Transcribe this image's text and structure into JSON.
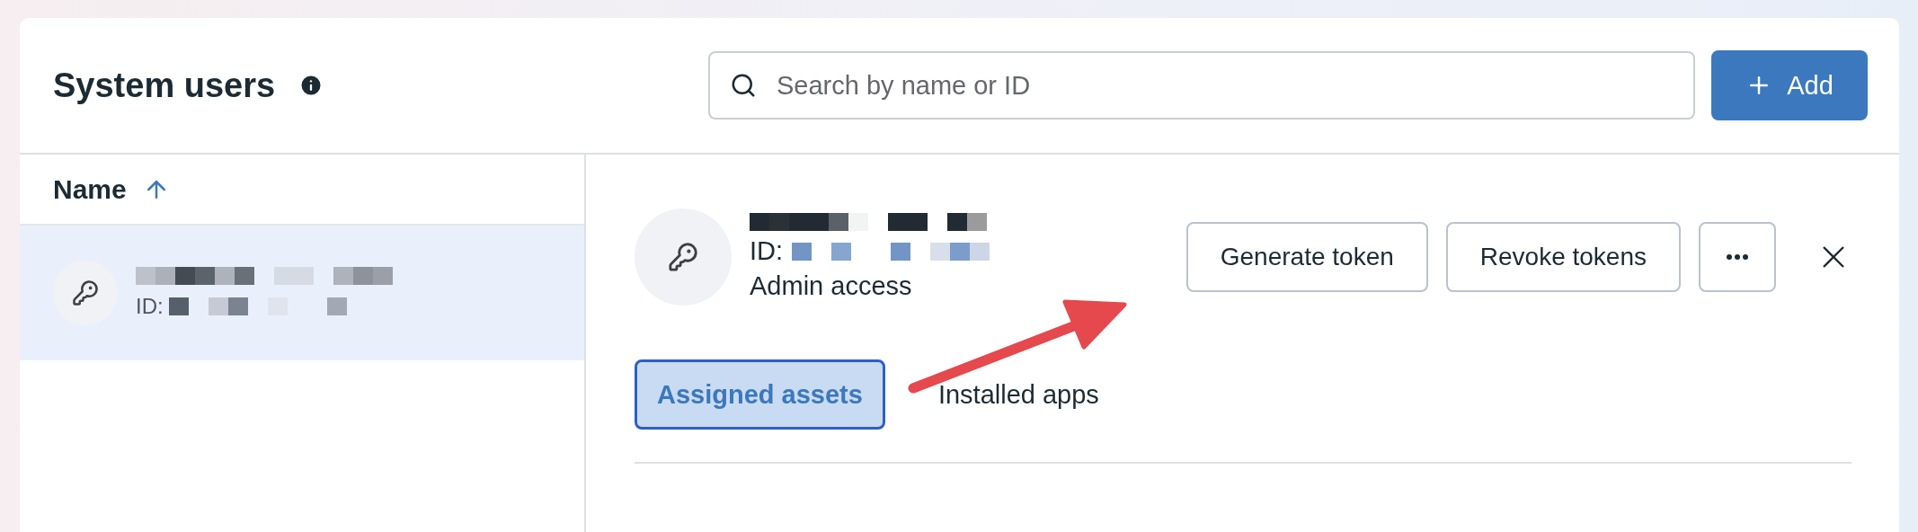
{
  "header": {
    "title": "System users",
    "search": {
      "placeholder": "Search by name or ID"
    },
    "add_button": "Add"
  },
  "list": {
    "column": "Name",
    "sorted_ascending": true,
    "rows": [
      {
        "id_label": "ID:",
        "selected": true
      }
    ]
  },
  "detail": {
    "id_label": "ID:",
    "access": "Admin access",
    "actions": [
      "Generate token",
      "Revoke tokens"
    ],
    "tabs": [
      {
        "label": "Assigned assets",
        "selected": true
      },
      {
        "label": "Installed apps",
        "selected": false
      }
    ]
  }
}
